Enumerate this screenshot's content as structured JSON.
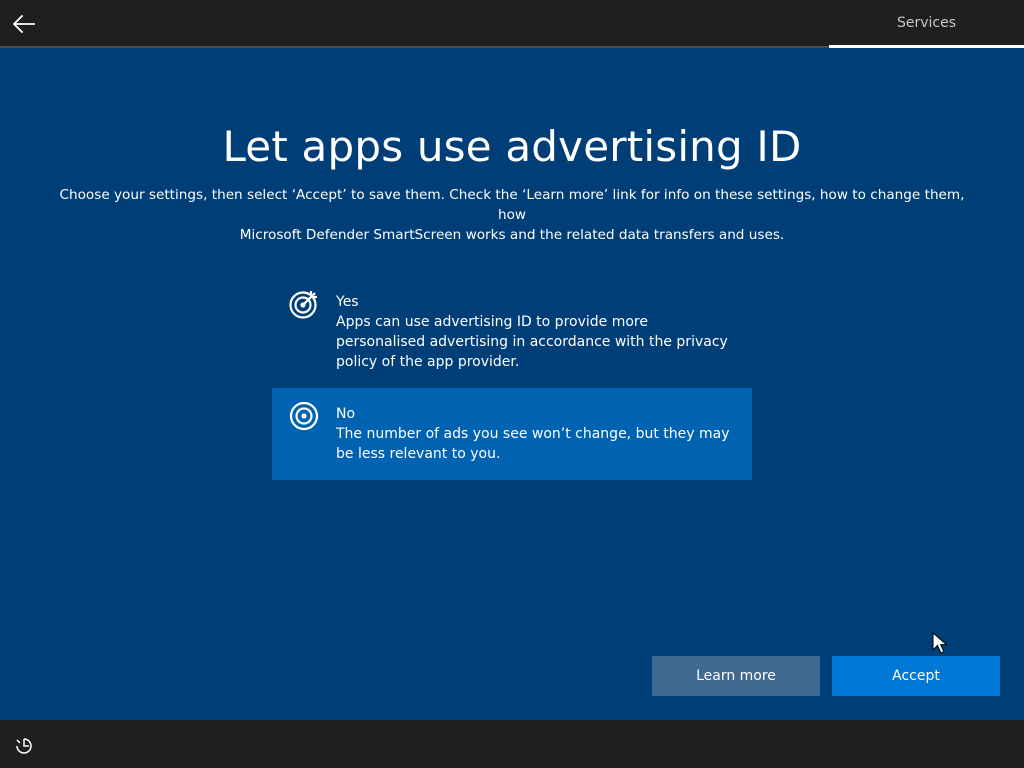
{
  "header": {
    "back_icon": "back-arrow-icon",
    "tab_label": "Services"
  },
  "main": {
    "title": "Let apps use advertising ID",
    "subtitle_line1": "Choose your settings, then select ‘Accept’ to save them. Check the ‘Learn more’ link for info on these settings, how to change them, how",
    "subtitle_line2": "Microsoft Defender SmartScreen works and the related data transfers and uses.",
    "options": [
      {
        "title": "Yes",
        "desc": "Apps can use advertising ID to provide more personalised advertising in accordance with the privacy policy of the app provider.",
        "icon": "target-with-arrow-icon",
        "selected": false
      },
      {
        "title": "No",
        "desc": "The number of ads you see won’t change, but they may be less relevant to you.",
        "icon": "target-icon",
        "selected": true
      }
    ]
  },
  "buttons": {
    "learn_more": "Learn more",
    "accept": "Accept"
  },
  "footer": {
    "ease_icon": "ease-of-access-icon"
  },
  "colors": {
    "background": "#003e77",
    "selected_option": "#0063b1",
    "accept_button": "#0078d7",
    "learn_more_button": "#3f6991",
    "bars": "#1f1f1f"
  }
}
